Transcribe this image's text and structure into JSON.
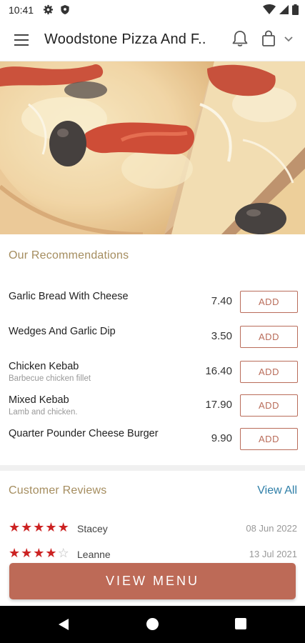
{
  "status_bar": {
    "time": "10:41"
  },
  "app_bar": {
    "title": "Woodstone Pizza And F.."
  },
  "recommendations": {
    "title": "Our Recommendations",
    "add_label": "ADD",
    "items": [
      {
        "name": "Garlic Bread With Cheese",
        "description": "",
        "price": "7.40"
      },
      {
        "name": "Wedges And Garlic Dip",
        "description": "",
        "price": "3.50"
      },
      {
        "name": "Chicken Kebab",
        "description": "Barbecue chicken fillet",
        "price": "16.40"
      },
      {
        "name": "Mixed Kebab",
        "description": "Lamb and chicken.",
        "price": "17.90"
      },
      {
        "name": "Quarter Pounder Cheese Burger",
        "description": "",
        "price": "9.90"
      }
    ]
  },
  "reviews": {
    "title": "Customer Reviews",
    "view_all": "View All",
    "items": [
      {
        "name": "Stacey",
        "date": "08 Jun 2022",
        "rating": 5
      },
      {
        "name": "Leanne",
        "date": "13 Jul 2021",
        "rating": 4
      }
    ]
  },
  "view_menu_label": "VIEW MENU",
  "colors": {
    "accent": "#bd6a57",
    "section_title": "#a58d5f",
    "link": "#2f7fa8",
    "star": "#cc2222"
  }
}
